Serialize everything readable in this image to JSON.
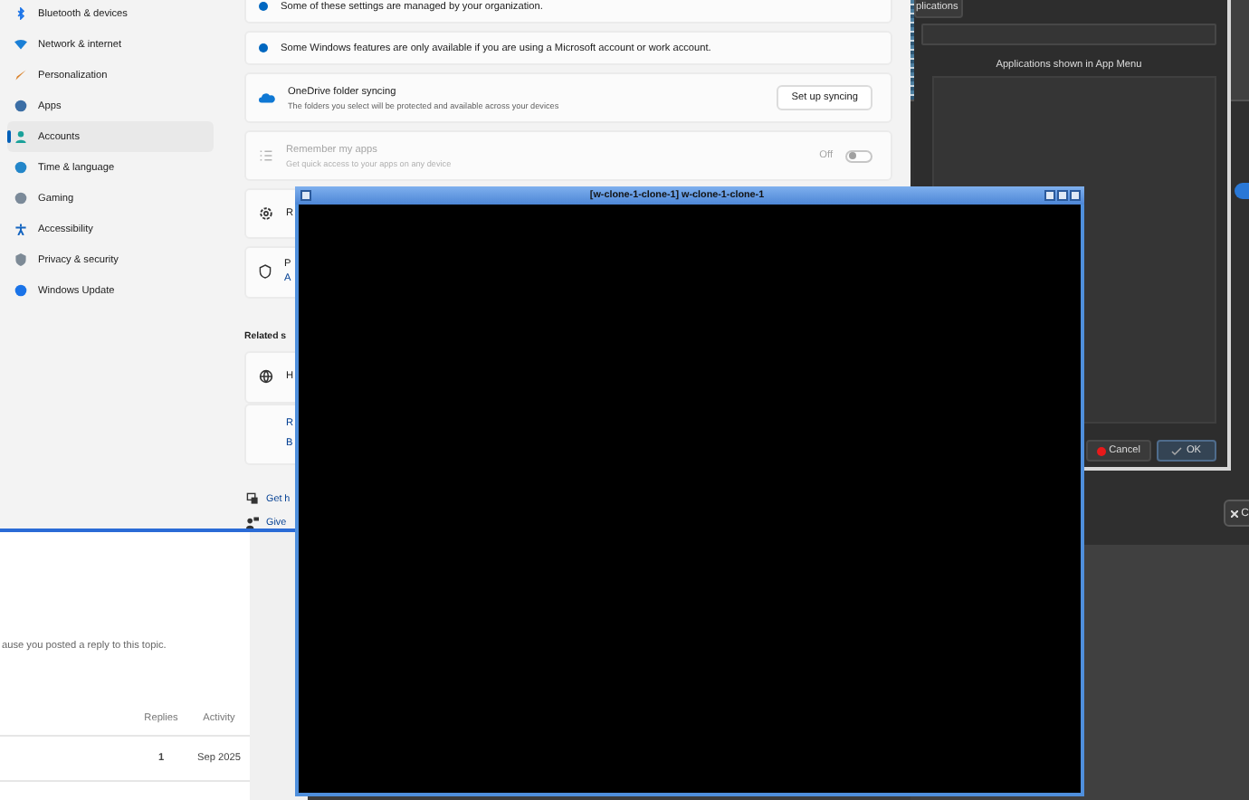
{
  "forum_page": {
    "notice": "ause you posted a reply to this topic.",
    "columns": [
      "Replies",
      "Activity"
    ],
    "rows": [
      {
        "replies": "1",
        "activity": "Sep 2025"
      }
    ]
  },
  "settings_window": {
    "sidebar_items": [
      {
        "label": "Bluetooth & devices",
        "selected": false
      },
      {
        "label": "Network & internet",
        "selected": false
      },
      {
        "label": "Personalization",
        "selected": false
      },
      {
        "label": "Apps",
        "selected": false
      },
      {
        "label": "Accounts",
        "selected": true
      },
      {
        "label": "Time & language",
        "selected": false
      },
      {
        "label": "Gaming",
        "selected": false
      },
      {
        "label": "Accessibility",
        "selected": false
      },
      {
        "label": "Privacy & security",
        "selected": false
      },
      {
        "label": "Windows Update",
        "selected": false
      }
    ],
    "notices": [
      "Some of these settings are managed by your organization.",
      "Some Windows features are only available if you are using a Microsoft account or work account."
    ],
    "onedrive": {
      "title": "OneDrive folder syncing",
      "description": "The folders you select will be protected and available across your devices",
      "button": "Set up syncing"
    },
    "remember_apps": {
      "title": "Remember my apps",
      "description": "Get quick access to your apps on any device",
      "toggle_label": "Off",
      "on": false,
      "disabled": true
    },
    "cut_cards": [
      {
        "kind": "gear",
        "title": "R"
      },
      {
        "kind": "shield",
        "title": "P",
        "link": "A"
      }
    ],
    "related_heading": "Related s",
    "related_card": {
      "title": "H",
      "links": [
        "R",
        "B"
      ]
    },
    "footer_links": [
      {
        "kind": "help",
        "label": "Get h"
      },
      {
        "kind": "feedback",
        "label": "Give"
      }
    ]
  },
  "app_menu_dialog": {
    "tab": "plications",
    "list_label": "Applications shown in App Menu",
    "buttons": [
      {
        "kind": "cancel",
        "label": "Cancel"
      },
      {
        "kind": "ok",
        "label": "OK"
      }
    ]
  },
  "back_window": {
    "toggle_on": true,
    "button": "C"
  },
  "terminal_window": {
    "title": "[w-clone-1-clone-1] w-clone-1-clone-1"
  }
}
